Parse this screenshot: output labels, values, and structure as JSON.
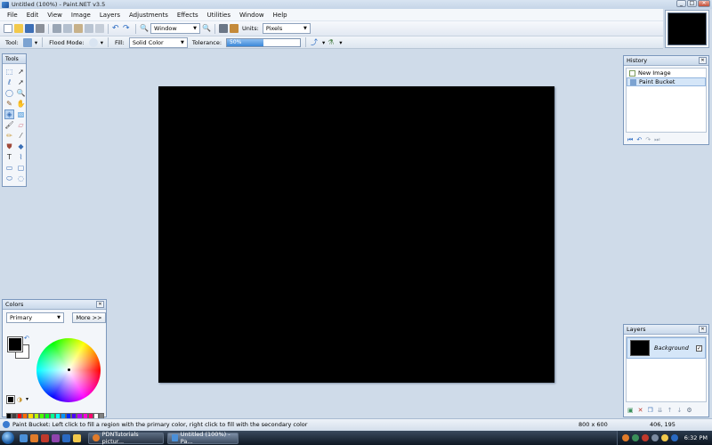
{
  "window": {
    "title": "Untitled (100%) - Paint.NET v3.5",
    "controls": [
      "_",
      "□",
      "✕"
    ]
  },
  "menu": {
    "items": [
      "File",
      "Edit",
      "View",
      "Image",
      "Layers",
      "Adjustments",
      "Effects",
      "Utilities",
      "Window",
      "Help"
    ]
  },
  "toolbar": {
    "window_dropdown": "Window",
    "units_label": "Units:",
    "units_value": "Pixels"
  },
  "tool_options": {
    "tool_label": "Tool:",
    "flood_mode_label": "Flood Mode:",
    "fill_label": "Fill:",
    "fill_value": "Solid Color",
    "tolerance_label": "Tolerance:",
    "tolerance_value": "50%",
    "tolerance_fraction": 0.5
  },
  "tools_panel": {
    "title": "Tools"
  },
  "history_panel": {
    "title": "History",
    "items": [
      {
        "label": "New Image",
        "selected": false
      },
      {
        "label": "Paint Bucket",
        "selected": true
      }
    ]
  },
  "colors_panel": {
    "title": "Colors",
    "mode_value": "Primary",
    "more_button": "More >>",
    "primary_color": "#000000",
    "secondary_color": "#ffffff",
    "palette": [
      "#000000",
      "#404040",
      "#ff0000",
      "#ff6a00",
      "#ffd800",
      "#b6ff00",
      "#4cff00",
      "#00ff21",
      "#00ff90",
      "#00ffff",
      "#0094ff",
      "#0026ff",
      "#4800ff",
      "#b200ff",
      "#ff00dc",
      "#ff006e",
      "#ffffff",
      "#808080"
    ]
  },
  "layers_panel": {
    "title": "Layers",
    "layers": [
      {
        "name": "Background",
        "visible": true
      }
    ]
  },
  "canvas": {
    "fill_color": "#000000"
  },
  "status_bar": {
    "message": "Paint Bucket: Left click to fill a region with the primary color, right click to fill with the secondary color",
    "image_size": "800 x 600",
    "cursor_position": "406, 195"
  },
  "taskbar": {
    "buttons": [
      {
        "label": "PDNTutorials pictur...",
        "active": false
      },
      {
        "label": "Untitled (100%) - Pa...",
        "active": true
      }
    ],
    "clock": "6:32 PM"
  }
}
